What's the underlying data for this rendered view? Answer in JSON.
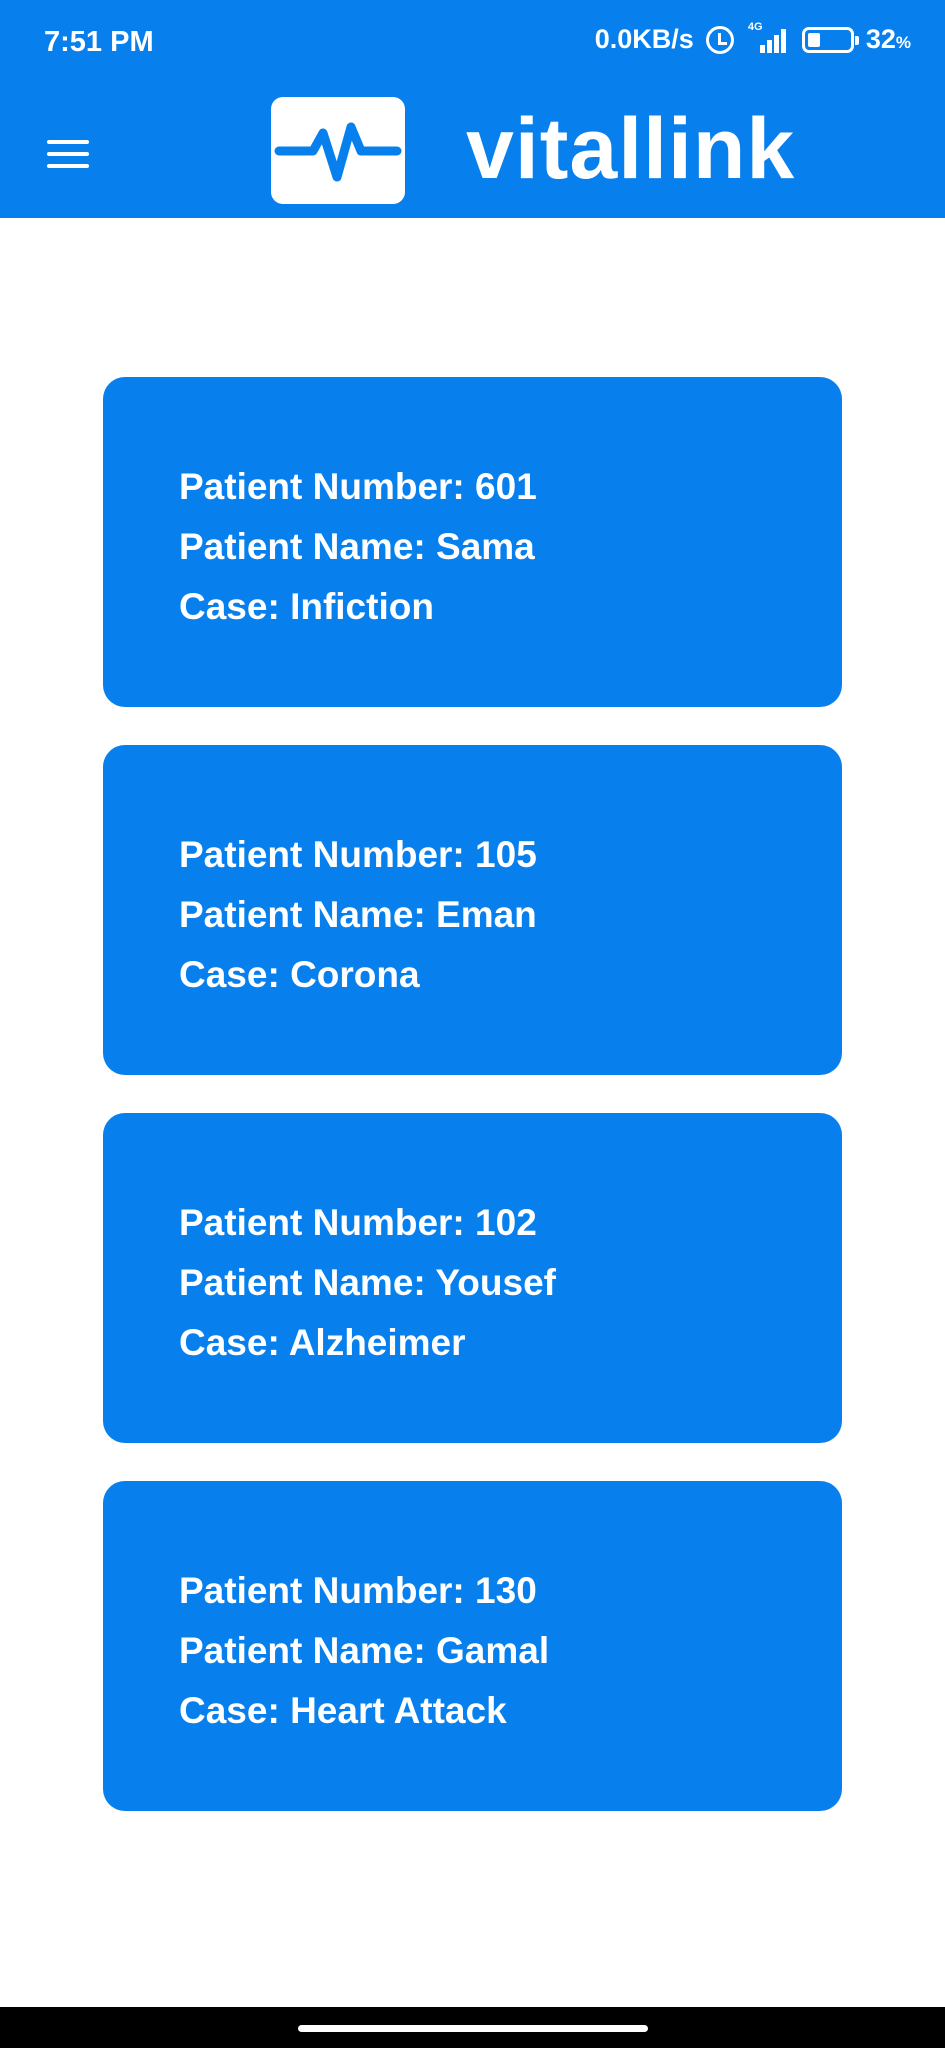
{
  "status_bar": {
    "time": "7:51 PM",
    "network_speed": "0.0KB/s",
    "network_type": "4G",
    "battery_percent": "32",
    "battery_unit": "%"
  },
  "app_bar": {
    "brand": "vitallink",
    "menu_icon": "hamburger-menu-icon",
    "logo_icon": "heartbeat-pulse-icon",
    "color": "#0780ee"
  },
  "patients": [
    {
      "number_label": "Patient Number:",
      "number": "601",
      "name_label": "Patient Name:",
      "name": "Sama",
      "case_label": "Case:",
      "case": "Infiction"
    },
    {
      "number_label": "Patient Number:",
      "number": "105",
      "name_label": "Patient Name:",
      "name": "Eman",
      "case_label": "Case:",
      "case": "Corona"
    },
    {
      "number_label": "Patient Number:",
      "number": "102",
      "name_label": "Patient Name:",
      "name": "Yousef",
      "case_label": "Case:",
      "case": "Alzheimer"
    },
    {
      "number_label": "Patient Number:",
      "number": "130",
      "name_label": "Patient Name:",
      "name": "Gamal",
      "case_label": "Case:",
      "case": "Heart Attack"
    }
  ]
}
